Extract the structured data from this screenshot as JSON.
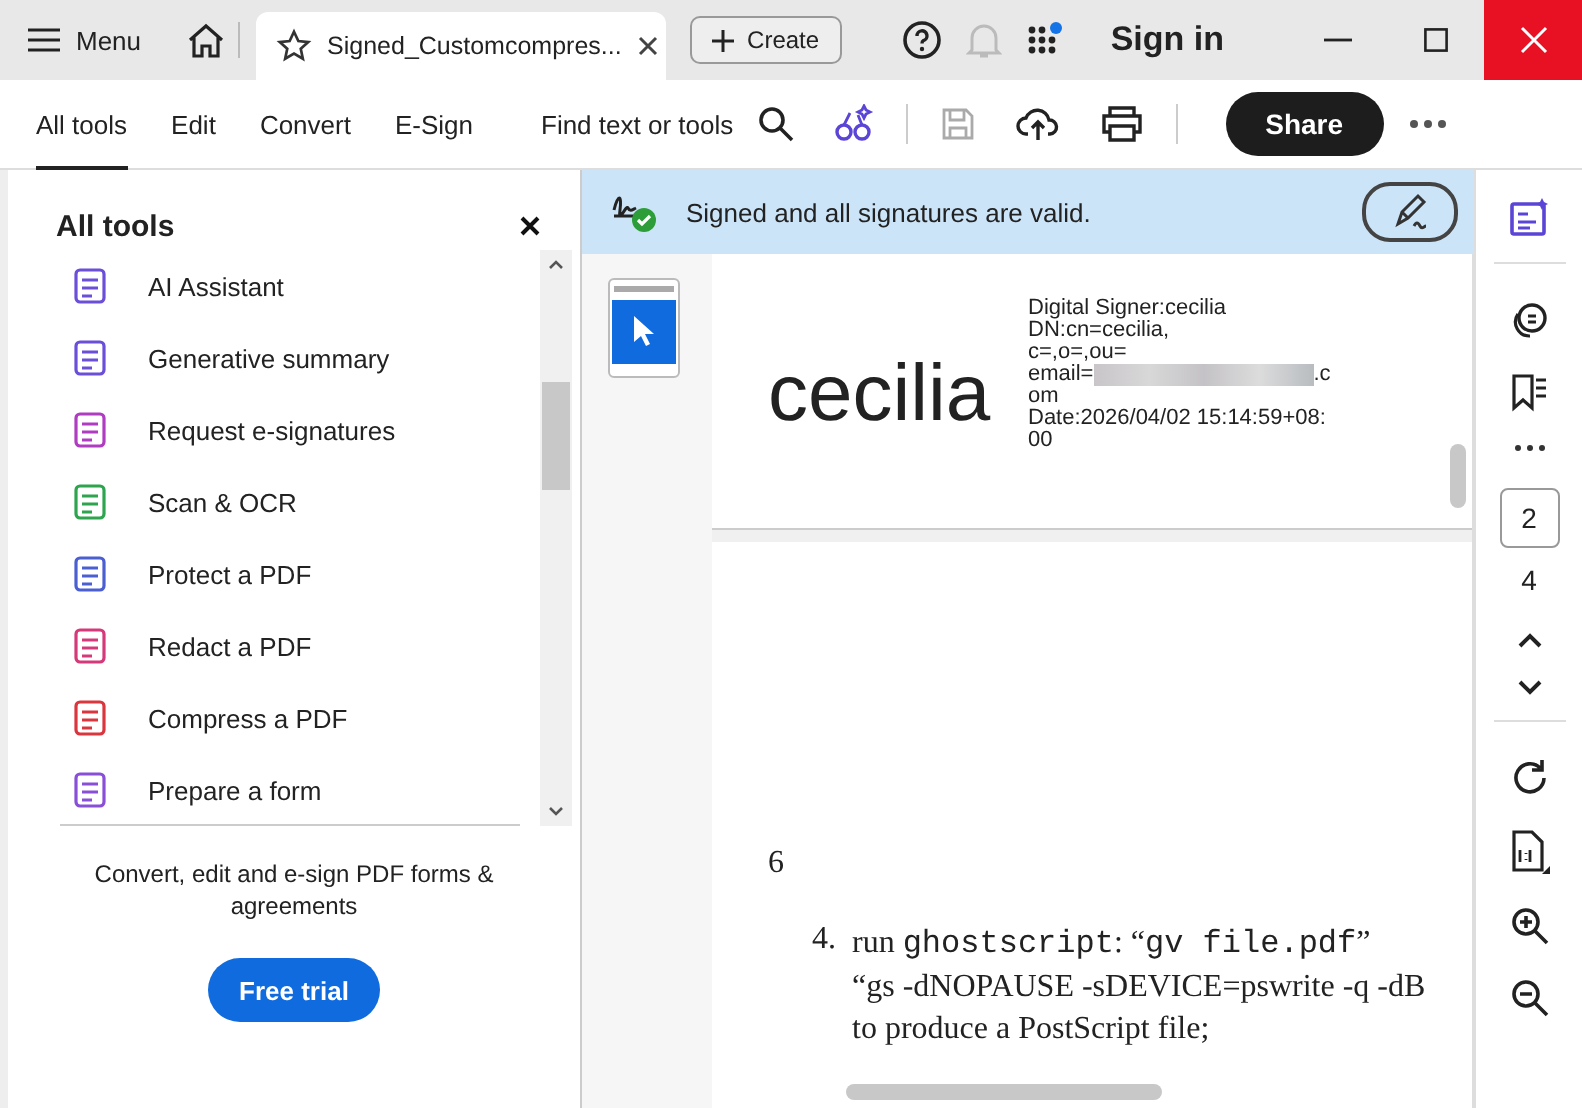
{
  "title_bar": {
    "menu_label": "Menu",
    "tab_title": "Signed_Customcompres...",
    "create_label": "Create",
    "sign_in": "Sign in"
  },
  "toolbar": {
    "tabs": [
      {
        "label": "All tools",
        "selected": true
      },
      {
        "label": "Edit",
        "selected": false
      },
      {
        "label": "Convert",
        "selected": false
      },
      {
        "label": "E-Sign",
        "selected": false
      }
    ],
    "search_label": "Find text or tools",
    "share_label": "Share"
  },
  "sidebar": {
    "title": "All tools",
    "tools": [
      {
        "label": "AI Assistant",
        "color": "#6b4fd8"
      },
      {
        "label": "Generative summary",
        "color": "#6b4fd8"
      },
      {
        "label": "Request e-signatures",
        "color": "#b03cc2"
      },
      {
        "label": "Scan & OCR",
        "color": "#2ea44f"
      },
      {
        "label": "Protect a PDF",
        "color": "#4b5fd1"
      },
      {
        "label": "Redact a PDF",
        "color": "#d43a7a"
      },
      {
        "label": "Compress a PDF",
        "color": "#d9363e"
      },
      {
        "label": "Prepare a form",
        "color": "#8a4fd8"
      }
    ],
    "promo": "Convert, edit and e-sign PDF forms & agreements",
    "cta": "Free trial"
  },
  "signature_banner": {
    "message": "Signed and all signatures are valid."
  },
  "document": {
    "signature_name": "cecilia",
    "details_before": [
      "Digital Signer:cecilia",
      "DN:cn=cecilia,",
      "c=,o=,ou="
    ],
    "email_prefix": "email=",
    "email_suffix": ".c",
    "details_after": [
      "om",
      "Date:2026/04/02 15:14:59+08:",
      "00"
    ],
    "page_label": "6",
    "list_number": "4.",
    "list_lines": [
      [
        {
          "kind": "text",
          "text": "run "
        },
        {
          "kind": "code",
          "text": "ghostscript"
        },
        {
          "kind": "text",
          "text": ": “"
        },
        {
          "kind": "code",
          "text": "gv file.pdf"
        },
        {
          "kind": "text",
          "text": "”"
        }
      ],
      [
        {
          "kind": "text",
          "text": "“gs -dNOPAUSE -sDEVICE=pswrite -q -dB"
        }
      ],
      [
        {
          "kind": "text",
          "text": "to produce a PostScript file;"
        }
      ]
    ]
  },
  "page_nav": {
    "current": "2",
    "total": "4"
  }
}
